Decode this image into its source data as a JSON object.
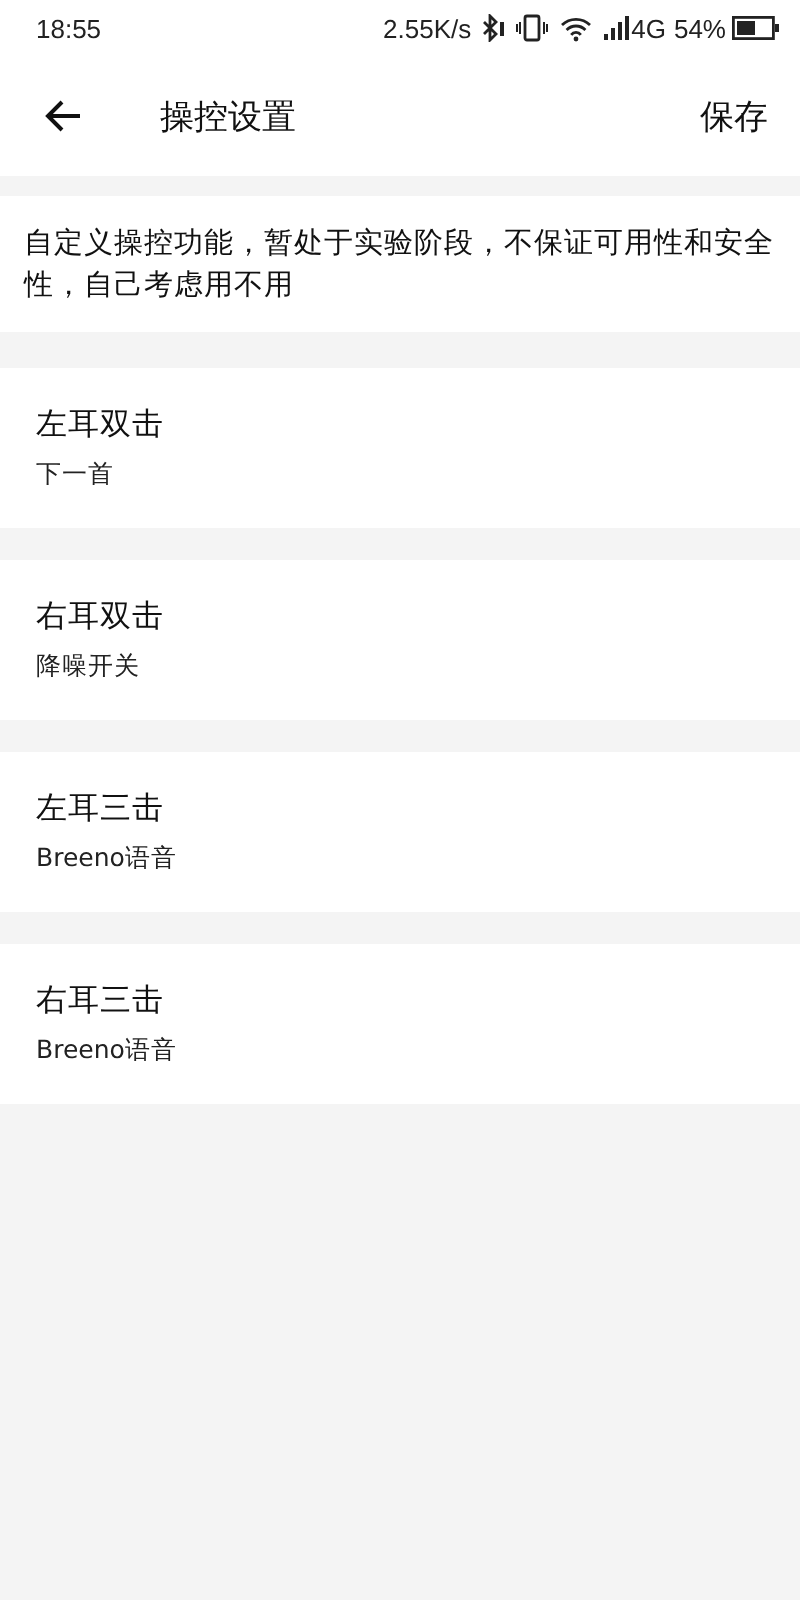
{
  "status_bar": {
    "time": "18:55",
    "speed": "2.55K/s",
    "network": "4G",
    "battery": "54%"
  },
  "header": {
    "title": "操控设置",
    "action": "保存"
  },
  "notice": "自定义操控功能，暂处于实验阶段，不保证可用性和安全性，自己考虑用不用",
  "settings": [
    {
      "title": "左耳双击",
      "value": "下一首"
    },
    {
      "title": "右耳双击",
      "value": "降噪开关"
    },
    {
      "title": "左耳三击",
      "value": "Breeno语音"
    },
    {
      "title": "右耳三击",
      "value": "Breeno语音"
    }
  ]
}
